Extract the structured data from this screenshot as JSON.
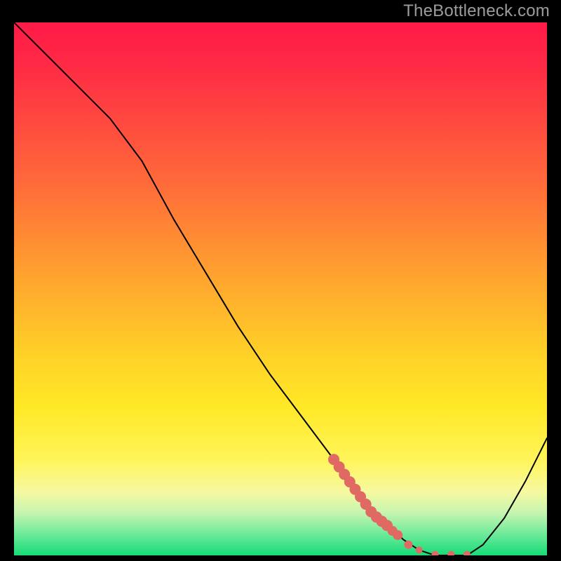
{
  "watermark": "TheBottleneck.com",
  "colors": {
    "background": "#000000",
    "watermark_text": "#9c9c9c",
    "curve": "#000000",
    "marker": "#e06a63",
    "gradient_top": "#ff1a48",
    "gradient_bottom": "#15dc78"
  },
  "chart_data": {
    "type": "line",
    "title": "",
    "xlabel": "",
    "ylabel": "",
    "xlim": [
      0,
      100
    ],
    "ylim": [
      0,
      100
    ],
    "axes_visible": false,
    "grid": false,
    "series": [
      {
        "name": "bottleneck-curve",
        "x": [
          0,
          6,
          12,
          18,
          24,
          30,
          36,
          42,
          48,
          54,
          60,
          66,
          70,
          73,
          76,
          79,
          82,
          85,
          88,
          92,
          96,
          100
        ],
        "values": [
          100,
          94,
          88,
          82,
          74,
          63,
          53,
          43,
          34,
          26,
          18,
          10,
          6,
          3,
          1,
          0,
          0,
          0,
          2,
          7,
          14,
          22
        ]
      }
    ],
    "markers": {
      "name": "highlight-segment",
      "shape": "circle",
      "color": "#e06a63",
      "x": [
        60.0,
        61.0,
        62.0,
        63.0,
        64.0,
        65.0,
        66.0,
        67.0,
        68.0,
        69.0,
        70.0,
        71.0,
        72.0,
        74.0,
        76.0,
        79.0,
        82.0,
        85.0
      ],
      "values": [
        18.0,
        16.6,
        15.2,
        13.8,
        12.4,
        11.0,
        9.6,
        8.2,
        7.2,
        6.4,
        5.6,
        4.6,
        3.8,
        2.0,
        1.0,
        0.2,
        0.2,
        0.2
      ],
      "radius": [
        8,
        8,
        8,
        8,
        8,
        8,
        8,
        8,
        8,
        8,
        8,
        7,
        7,
        6,
        5,
        5,
        5,
        5
      ]
    }
  }
}
